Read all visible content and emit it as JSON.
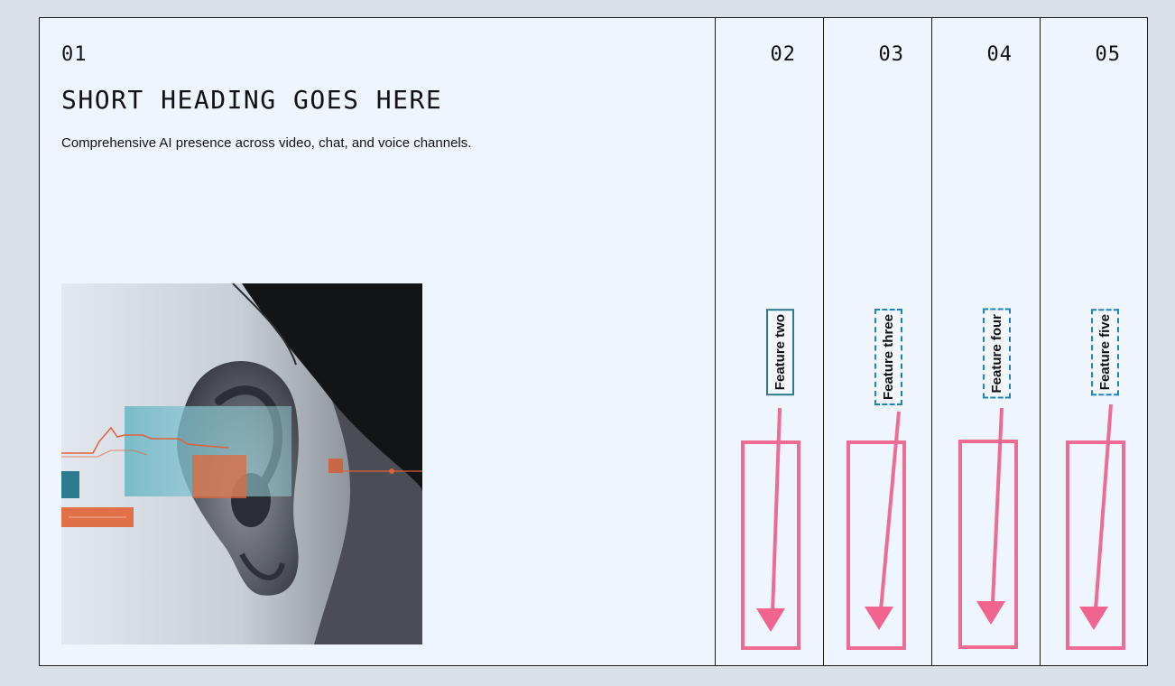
{
  "main": {
    "number": "01",
    "heading": "SHORT HEADING GOES HERE",
    "description": "Comprehensive AI presence across video, chat, and voice channels."
  },
  "features": [
    {
      "number": "02",
      "label": "Feature two"
    },
    {
      "number": "03",
      "label": "Feature three"
    },
    {
      "number": "04",
      "label": "Feature four"
    },
    {
      "number": "05",
      "label": "Feature five"
    }
  ],
  "colors": {
    "background": "#d9e0e7",
    "panel": "#eef5fd",
    "annotation": "#f0648f",
    "teal": "#2b7a8f",
    "orange": "#e0603a"
  }
}
